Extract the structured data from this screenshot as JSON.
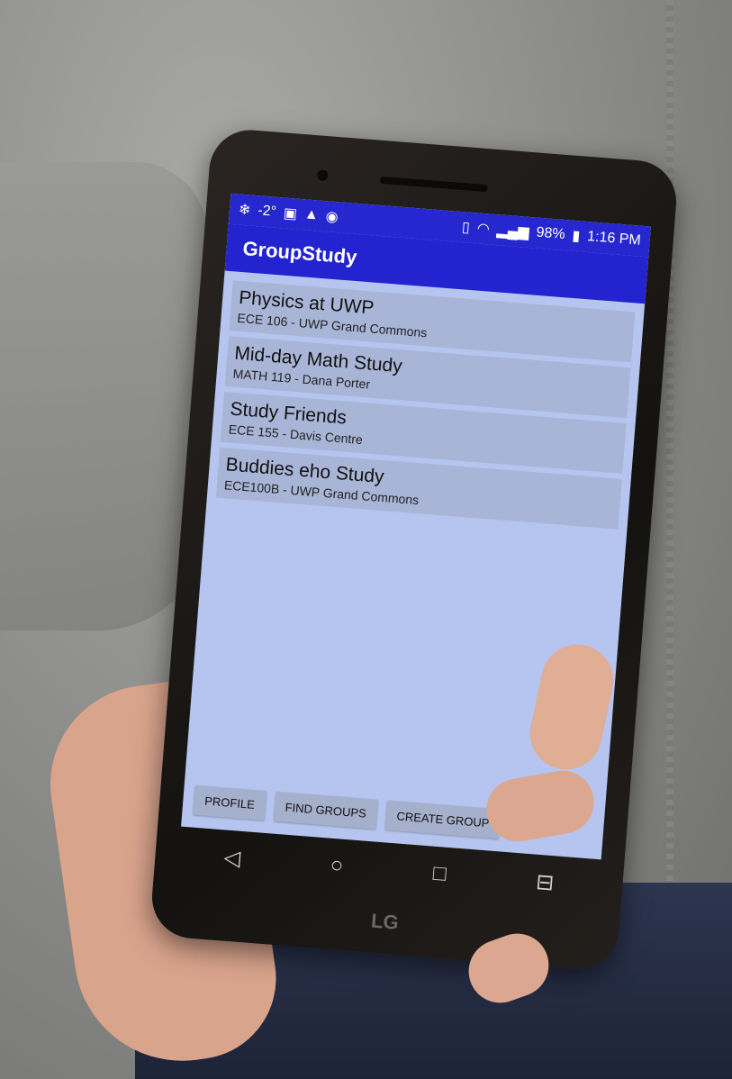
{
  "status": {
    "temperature": "-2°",
    "battery": "98%",
    "time": "1:16 PM"
  },
  "app": {
    "title": "GroupStudy"
  },
  "groups": [
    {
      "title": "Physics at UWP",
      "subtitle": "ECE 106 - UWP Grand Commons"
    },
    {
      "title": "Mid-day Math Study",
      "subtitle": "MATH 119 - Dana Porter"
    },
    {
      "title": "Study Friends",
      "subtitle": "ECE 155 - Davis Centre"
    },
    {
      "title": "Buddies eho Study",
      "subtitle": "ECE100B - UWP Grand Commons"
    }
  ],
  "buttons": {
    "profile": "PROFILE",
    "find_groups": "FIND GROUPS",
    "create_group": "CREATE GROUP"
  },
  "nav": {
    "back": "◁",
    "home": "○",
    "recents": "□",
    "dual": "⊟"
  },
  "device": {
    "brand": "LG"
  },
  "colors": {
    "appbar": "#2323cf",
    "screen": "#b6c5ef",
    "list_item": "#a9b5d6"
  }
}
